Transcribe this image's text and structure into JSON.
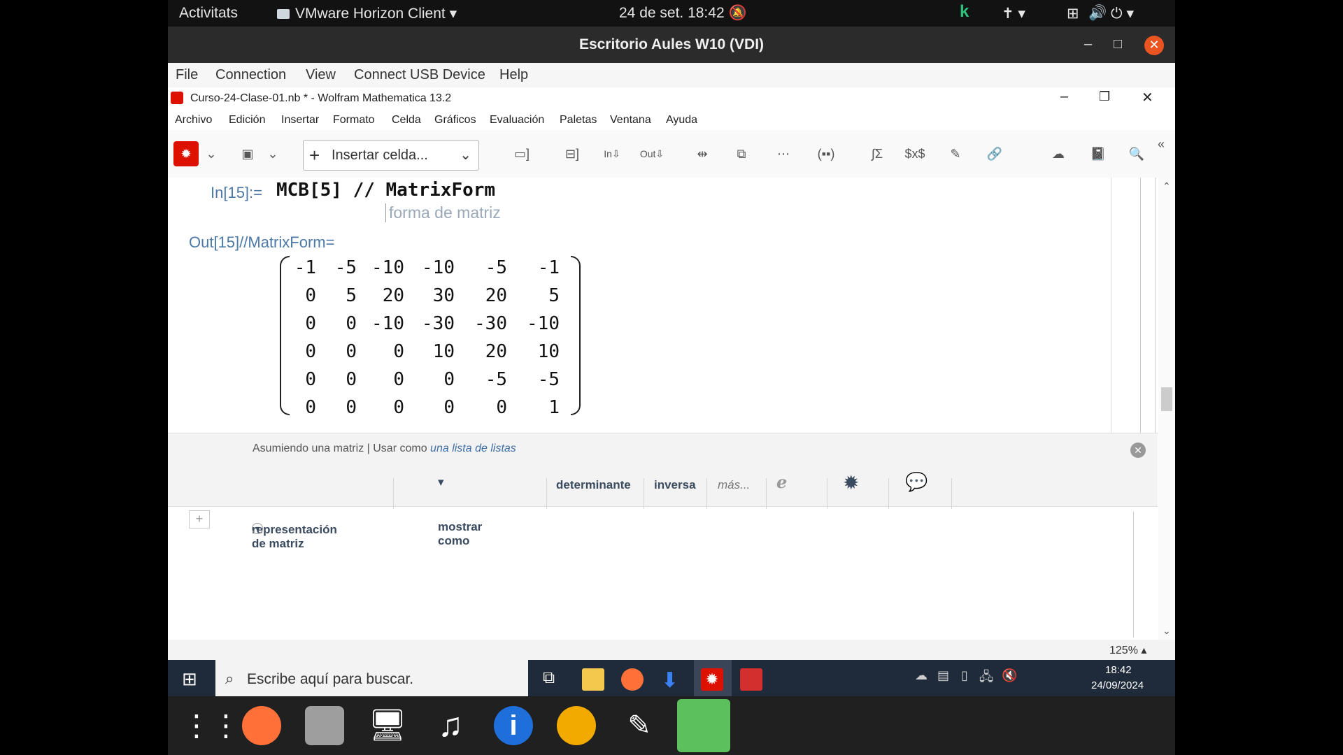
{
  "topbar": {
    "activities": "Activitats",
    "app_menu": "VMware Horizon Client",
    "clock": "24 de set.  18:42"
  },
  "vmware": {
    "title": "Escritorio Aules W10 (VDI)",
    "menu": [
      "File",
      "Connection",
      "View",
      "Connect USB Device",
      "Help"
    ]
  },
  "mathematica": {
    "title": "Curso-24-Clase-01.nb * - Wolfram Mathematica 13.2",
    "menu": [
      "Archivo",
      "Edición",
      "Insertar",
      "Formato",
      "Celda",
      "Gráficos",
      "Evaluación",
      "Paletas",
      "Ventana",
      "Ayuda"
    ],
    "insert_cell": "Insertar celda...",
    "input_label": "In[15]:=",
    "input_code": "MCB[5] // MatrixForm",
    "input_hint": "forma de matriz",
    "output_label": "Out[15]//MatrixForm=",
    "matrix": [
      [
        "-1",
        "-5",
        "-10",
        "-10",
        "-5",
        "-1"
      ],
      [
        "0",
        "5",
        "20",
        "30",
        "20",
        "5"
      ],
      [
        "0",
        "0",
        "-10",
        "-30",
        "-30",
        "-10"
      ],
      [
        "0",
        "0",
        "0",
        "10",
        "20",
        "10"
      ],
      [
        "0",
        "0",
        "0",
        "0",
        "-5",
        "-5"
      ],
      [
        "0",
        "0",
        "0",
        "0",
        "0",
        "1"
      ]
    ],
    "assist": {
      "assuming": "Asumiendo una matriz",
      "use_as": "Usar como",
      "use_as_link": "una lista de listas",
      "representation": "representación de matriz",
      "show_as": "mostrar como",
      "determinant": "determinante",
      "inverse": "inversa",
      "more": "más..."
    },
    "zoom": "125%"
  },
  "windows": {
    "search_placeholder": "Escribe aquí para buscar.",
    "time": "18:42",
    "date": "24/09/2024"
  }
}
